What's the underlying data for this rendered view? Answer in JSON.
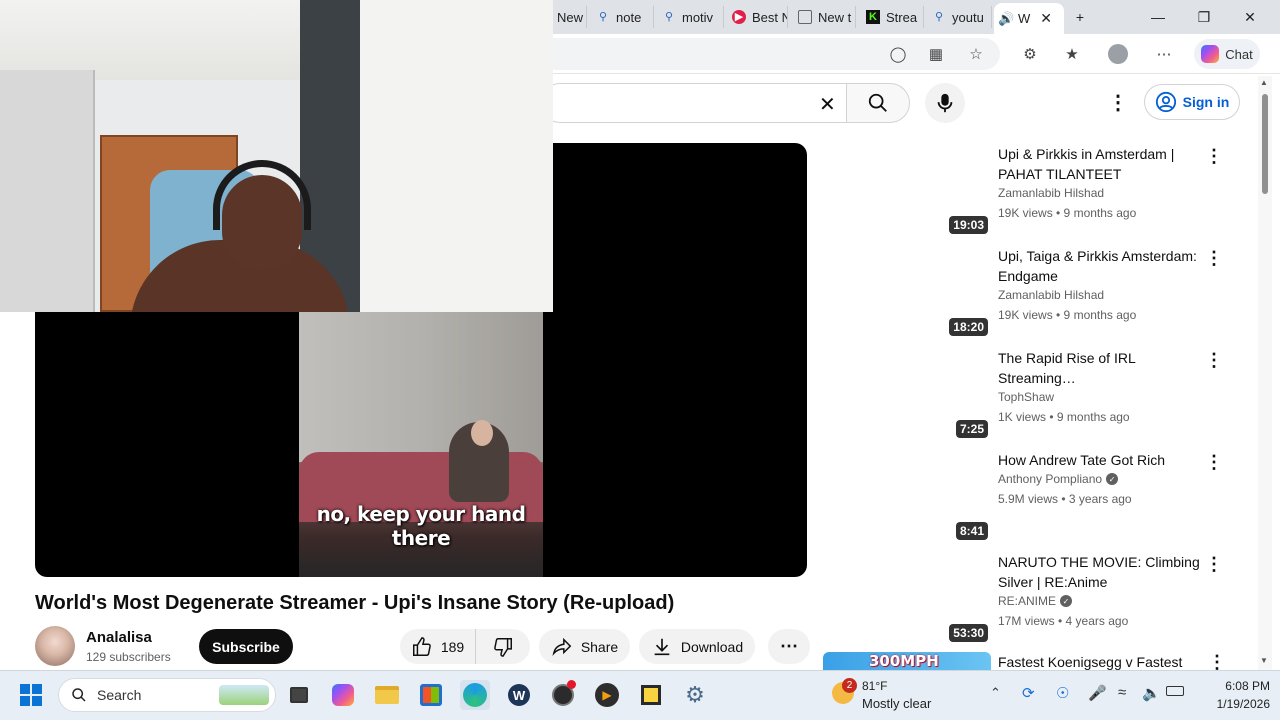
{
  "browser": {
    "tabs": [
      {
        "label": "New t",
        "icon": "page-icon"
      },
      {
        "label": "note",
        "icon": "search-icon"
      },
      {
        "label": "motiv",
        "icon": "search-icon"
      },
      {
        "label": "Best N",
        "icon": "music-icon"
      },
      {
        "label": "New t",
        "icon": "page-icon"
      },
      {
        "label": "Strea",
        "icon": "kick-icon"
      },
      {
        "label": "youtu",
        "icon": "search-icon"
      },
      {
        "label": "W",
        "icon": "speaker-icon"
      }
    ],
    "chat_label": "Chat"
  },
  "youtube": {
    "sign_in": "Sign in"
  },
  "video": {
    "subtitle": "no, keep your hand there",
    "title": "World's Most Degenerate Streamer - Upi's Insane Story (Re-upload)",
    "channel": "Analalisa",
    "subscribers": "129 subscribers",
    "subscribe_label": "Subscribe",
    "likes": "189",
    "share_label": "Share",
    "download_label": "Download"
  },
  "recommendations": [
    {
      "title": "Upi & Pirkkis in Amsterdam | PAHAT TILANTEET",
      "channel": "Zamanlabib Hilshad",
      "verified": false,
      "meta": "19K views • 9 months ago",
      "duration": "19:03"
    },
    {
      "title": "Upi, Taiga & Pirkkis Amsterdam: Endgame",
      "channel": "Zamanlabib Hilshad",
      "verified": false,
      "meta": "19K views • 9 months ago",
      "duration": "18:20"
    },
    {
      "title": "The Rapid Rise of IRL Streaming…",
      "channel": "TophShaw",
      "verified": false,
      "meta": "1K views • 9 months ago",
      "duration": "7:25"
    },
    {
      "title": "How Andrew Tate Got Rich",
      "channel": "Anthony Pompliano",
      "verified": true,
      "meta": "5.9M views • 3 years ago",
      "duration": "8:41"
    },
    {
      "title": "NARUTO THE MOVIE: Climbing Silver | RE:Anime",
      "channel": "RE:ANIME",
      "verified": true,
      "meta": "17M views • 4 years ago",
      "duration": "53:30"
    },
    {
      "title": "Fastest Koenigsegg v Fastest",
      "thumb_text": "300MPH"
    }
  ],
  "taskbar": {
    "search_placeholder": "Search",
    "weather_temp": "81°F",
    "weather_desc": "Mostly clear",
    "weather_badge": "2",
    "time": "6:08 PM",
    "date": "1/19/2026"
  }
}
